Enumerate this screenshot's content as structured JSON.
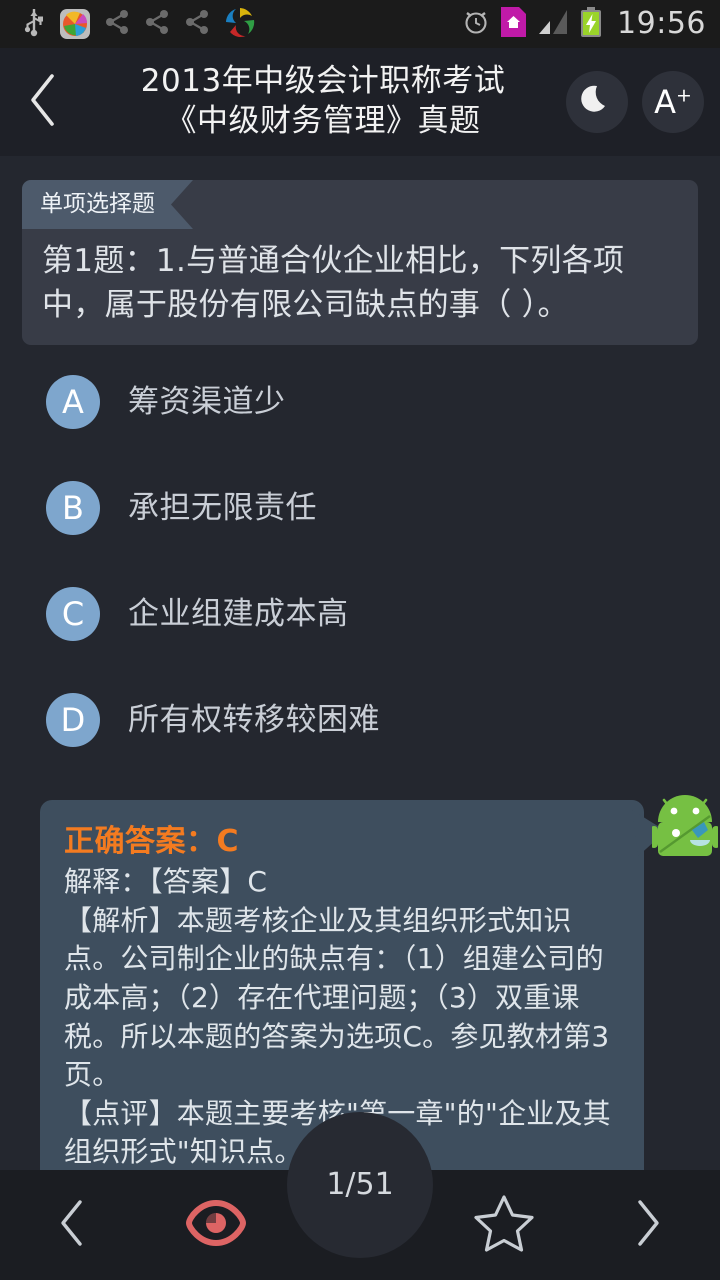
{
  "status_bar": {
    "time": "19:56",
    "icons_left": [
      "usb-icon",
      "app-icon",
      "share-icon",
      "share-icon",
      "share-icon",
      "swirl-logo-icon"
    ],
    "icons_right": [
      "alarm-icon",
      "sim-home-icon",
      "signal-icon",
      "battery-charging-icon"
    ]
  },
  "header": {
    "back_icon": "chevron-left-icon",
    "title_line1": "2013年中级会计职称考试",
    "title_line2": "《中级财务管理》真题",
    "night_mode_icon": "moon-icon",
    "font_size_label": "A",
    "font_size_sup": "+"
  },
  "question": {
    "type_tag": "单项选择题",
    "text": "第1题：1.与普通合伙企业相比，下列各项中，属于股份有限公司缺点的事（ ）。"
  },
  "options": [
    {
      "letter": "A",
      "label": "筹资渠道少"
    },
    {
      "letter": "B",
      "label": "承担无限责任"
    },
    {
      "letter": "C",
      "label": "企业组建成本高"
    },
    {
      "letter": "D",
      "label": "所有权转移较困难"
    }
  ],
  "answer": {
    "heading": "正确答案：C",
    "explanation": "解释：【答案】C\n【解析】本题考核企业及其组织形式知识点。公司制企业的缺点有：（1）组建公司的成本高；（2）存在代理问题；（3）双重课税。所以本题的答案为选项C。参见教材第3页。\n【点评】本题主要考核\"第一章\"的\"企业及其组织形式\"知识点。"
  },
  "mascot": {
    "name": "android-robot-icon"
  },
  "bottom_bar": {
    "prev_icon": "chevron-left-icon",
    "eye_icon": "eye-icon",
    "counter": "1/51",
    "star_icon": "star-outline-icon",
    "next_icon": "chevron-right-icon"
  },
  "colors": {
    "background": "#24272f",
    "card": "#383c47",
    "ribbon": "#4d5a6b",
    "option_circle": "#7ea6cd",
    "answer_panel": "#3e4e5e",
    "answer_accent": "#f47b20",
    "eye_red": "#dd6464",
    "battery_green": "#9ad32a"
  }
}
